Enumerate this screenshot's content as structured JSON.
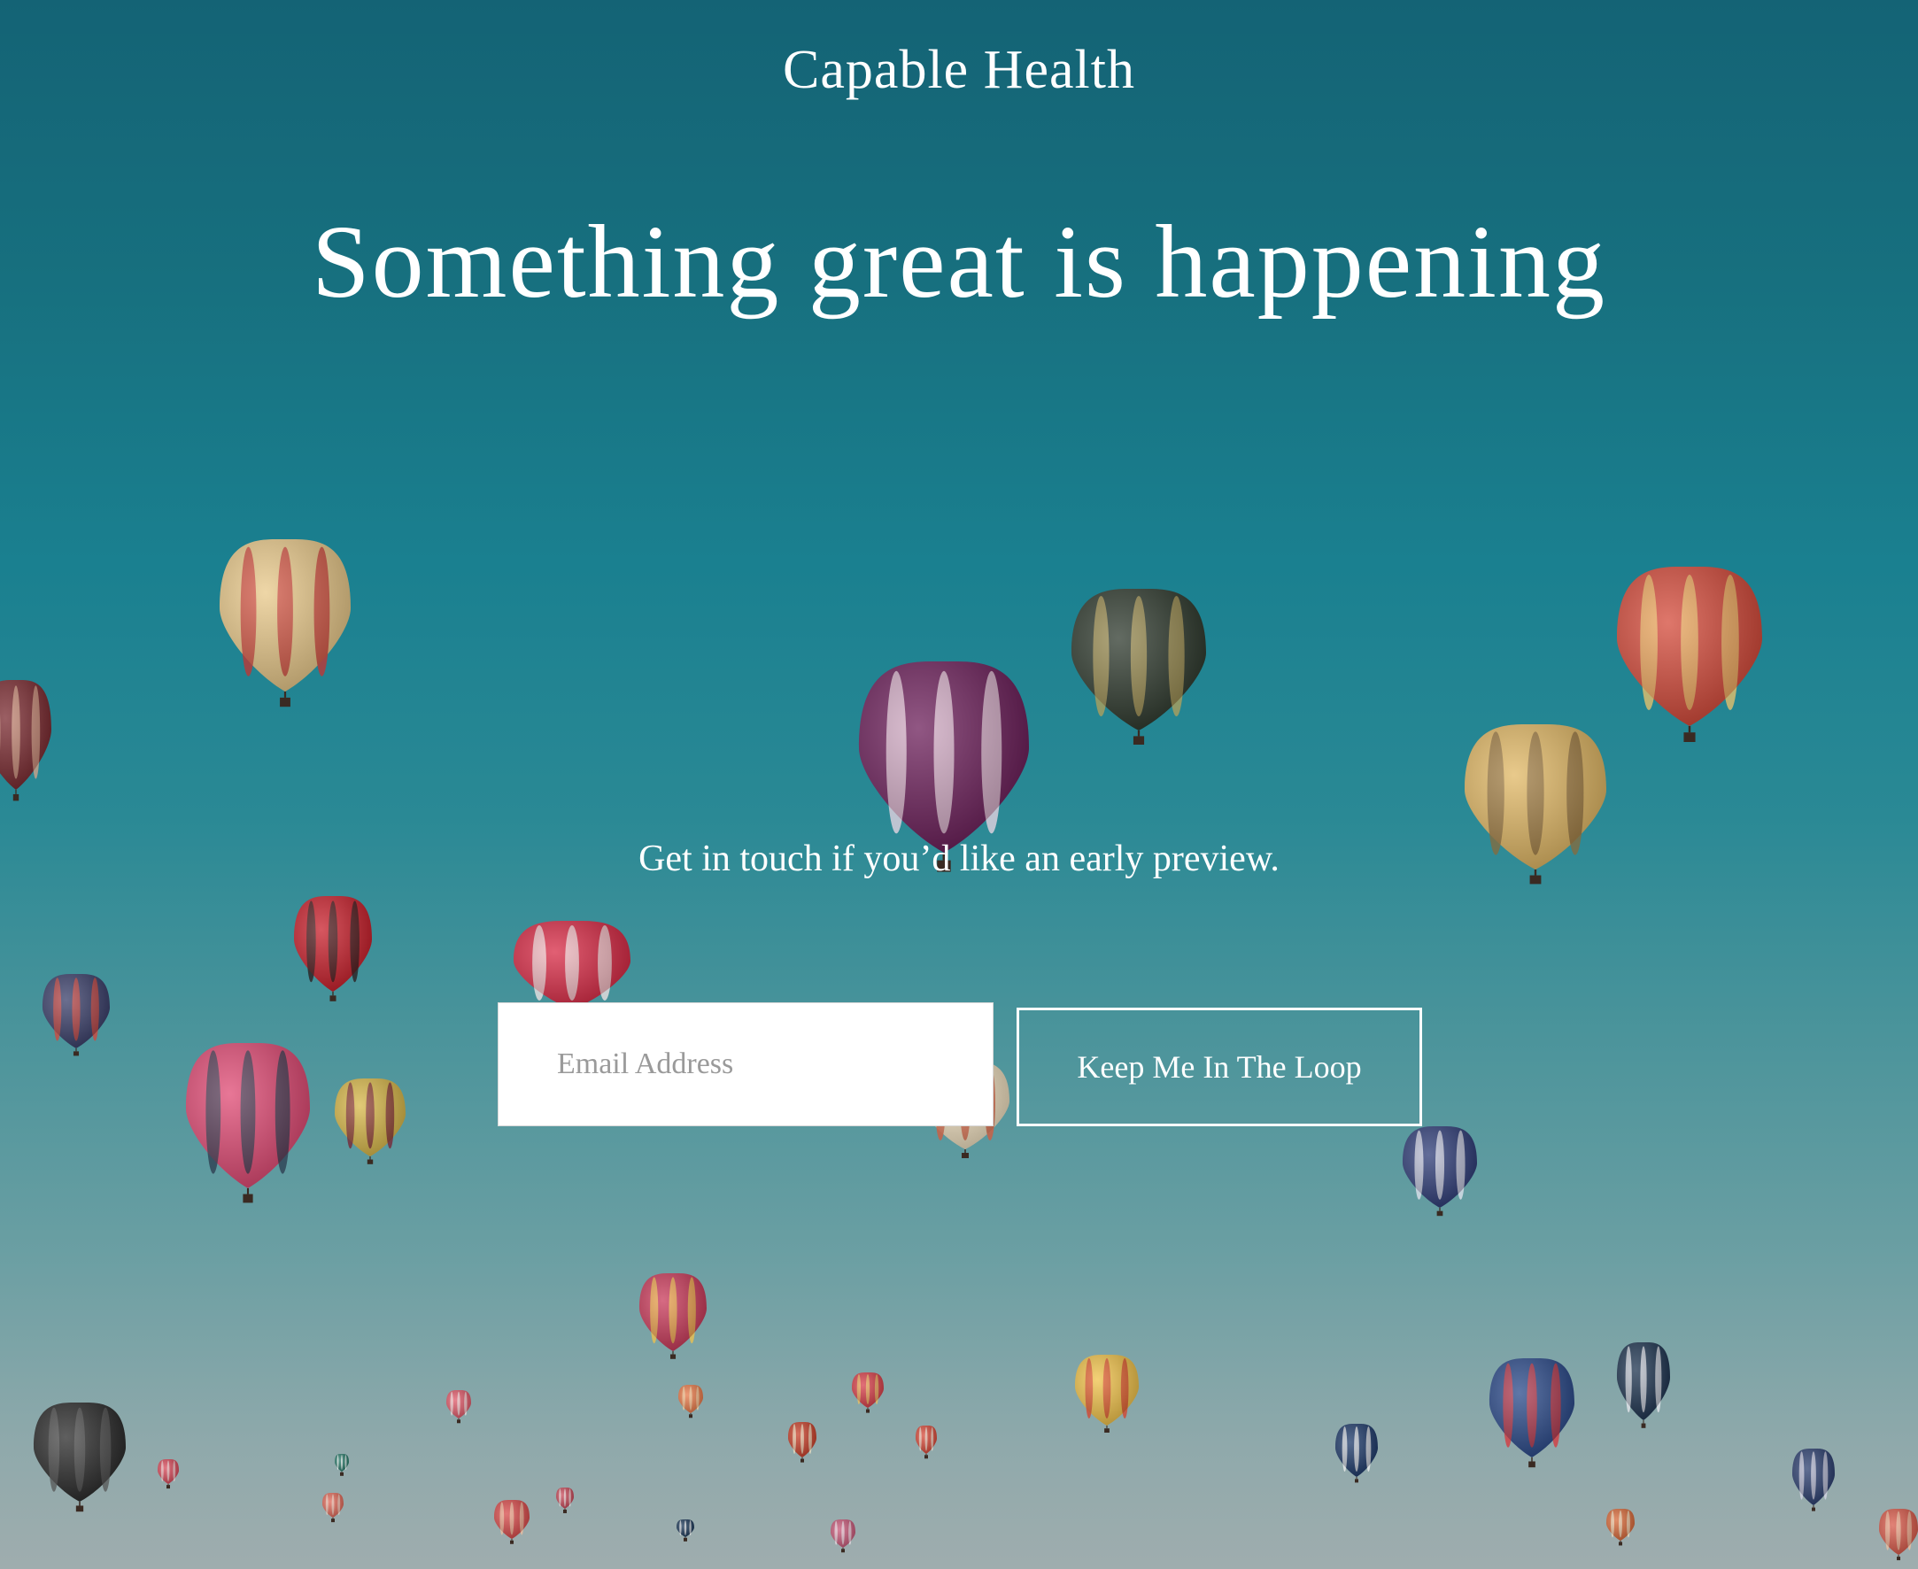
{
  "brand": {
    "name": "Capable Health"
  },
  "hero": {
    "headline": "Something great is happening",
    "subtext": "Get in touch if you’d like an early preview."
  },
  "signup": {
    "email_placeholder": "Email Address",
    "email_value": "",
    "submit_label": "Keep Me In The Loop"
  },
  "colors": {
    "sky_top": "#146375",
    "sky_mid": "#1a8090",
    "sky_bottom": "#9fadae",
    "text": "#ffffff"
  },
  "background_image": "hot-air-balloons-sky"
}
